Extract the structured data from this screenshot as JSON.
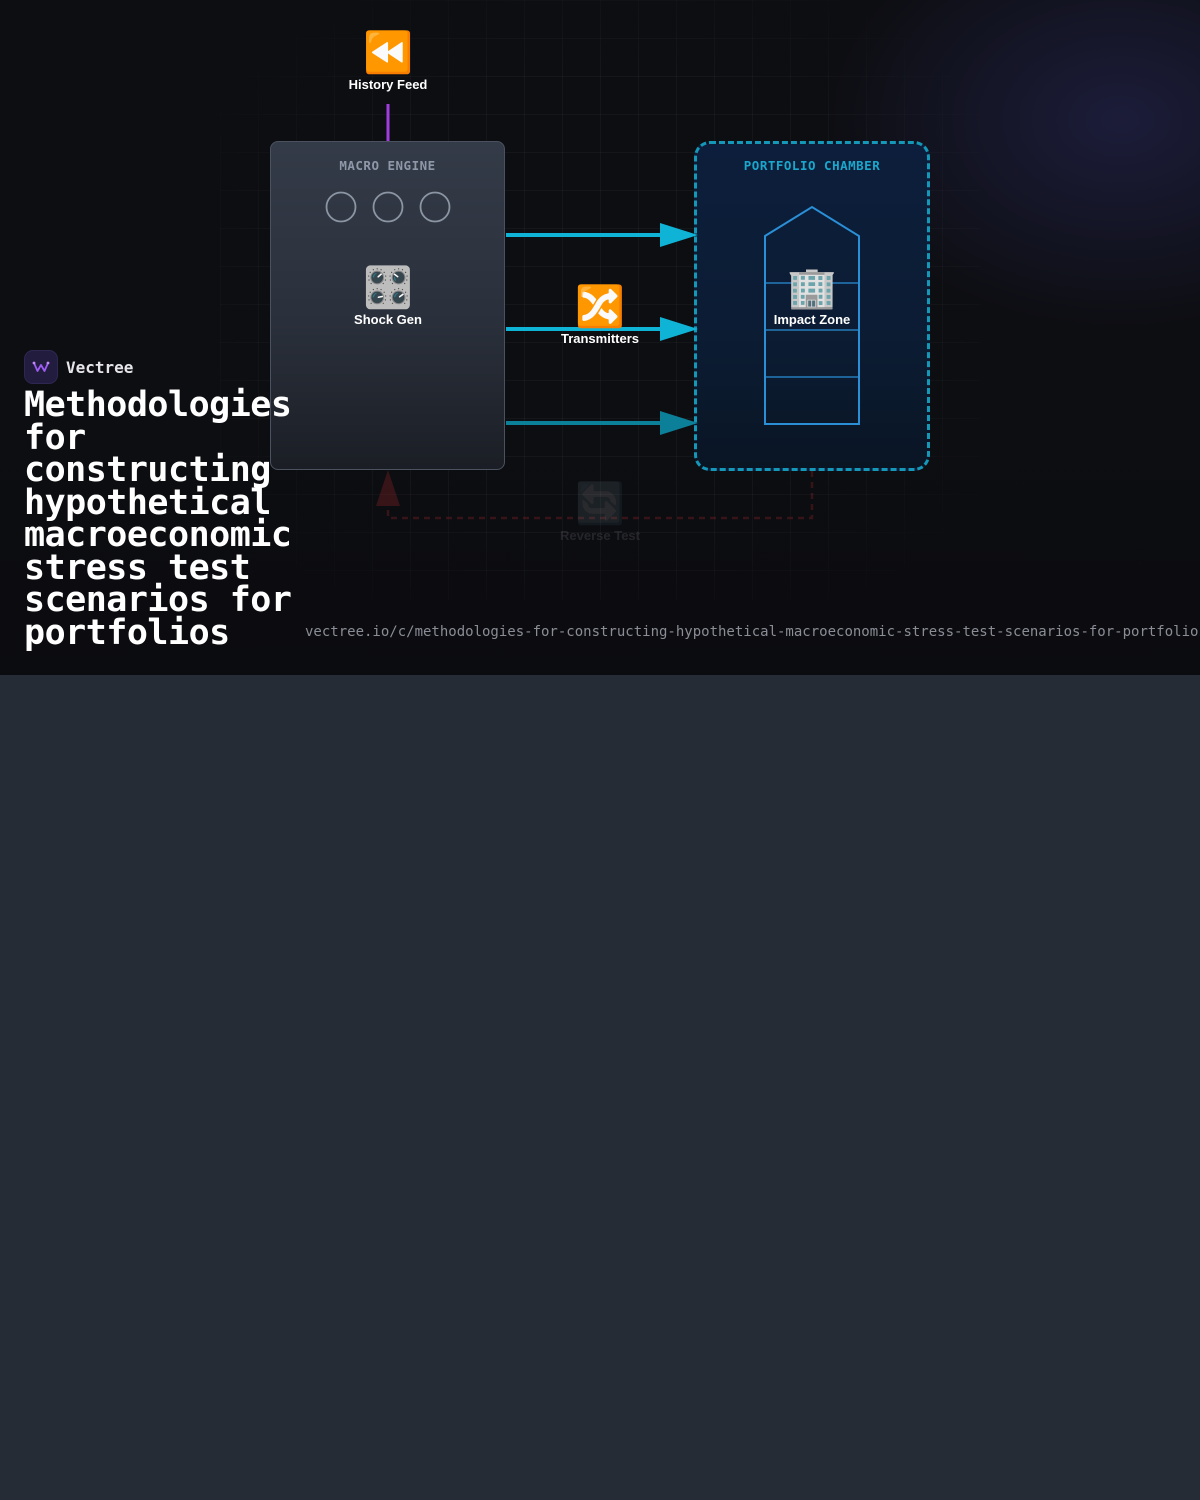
{
  "diagram": {
    "history_feed": {
      "icon": "rewind-icon",
      "emoji": "⏪",
      "label": "History Feed"
    },
    "engine": {
      "title": "MACRO ENGINE",
      "shock_gen": {
        "icon": "control-knobs-icon",
        "emoji": "🎛️",
        "label": "Shock Gen"
      }
    },
    "transmitters": {
      "icon": "shuffle-icon",
      "emoji": "🔀",
      "label": "Transmitters"
    },
    "chamber": {
      "title": "PORTFOLIO CHAMBER",
      "impact_zone": {
        "icon": "office-building-icon",
        "emoji": "🏢",
        "label": "Impact Zone"
      }
    },
    "reverse_test": {
      "icon": "counterclockwise-arrows-icon",
      "emoji": "🔄",
      "label": "Reverse Test"
    },
    "colors": {
      "accent_cyan": "#0fb3d6",
      "feed_purple": "#a23ee0",
      "reverse_red": "#b52a2a",
      "building_blue": "#2a8fd6"
    }
  },
  "brand": {
    "logo_icon": "vectree-logo-icon",
    "name": "Vectree"
  },
  "title": "Methodologies for constructing hypothetical macroeconomic stress test scenarios for portfolios",
  "url": "vectree.io/c/methodologies-for-constructing-hypothetical-macroeconomic-stress-test-scenarios-for-portfolios"
}
